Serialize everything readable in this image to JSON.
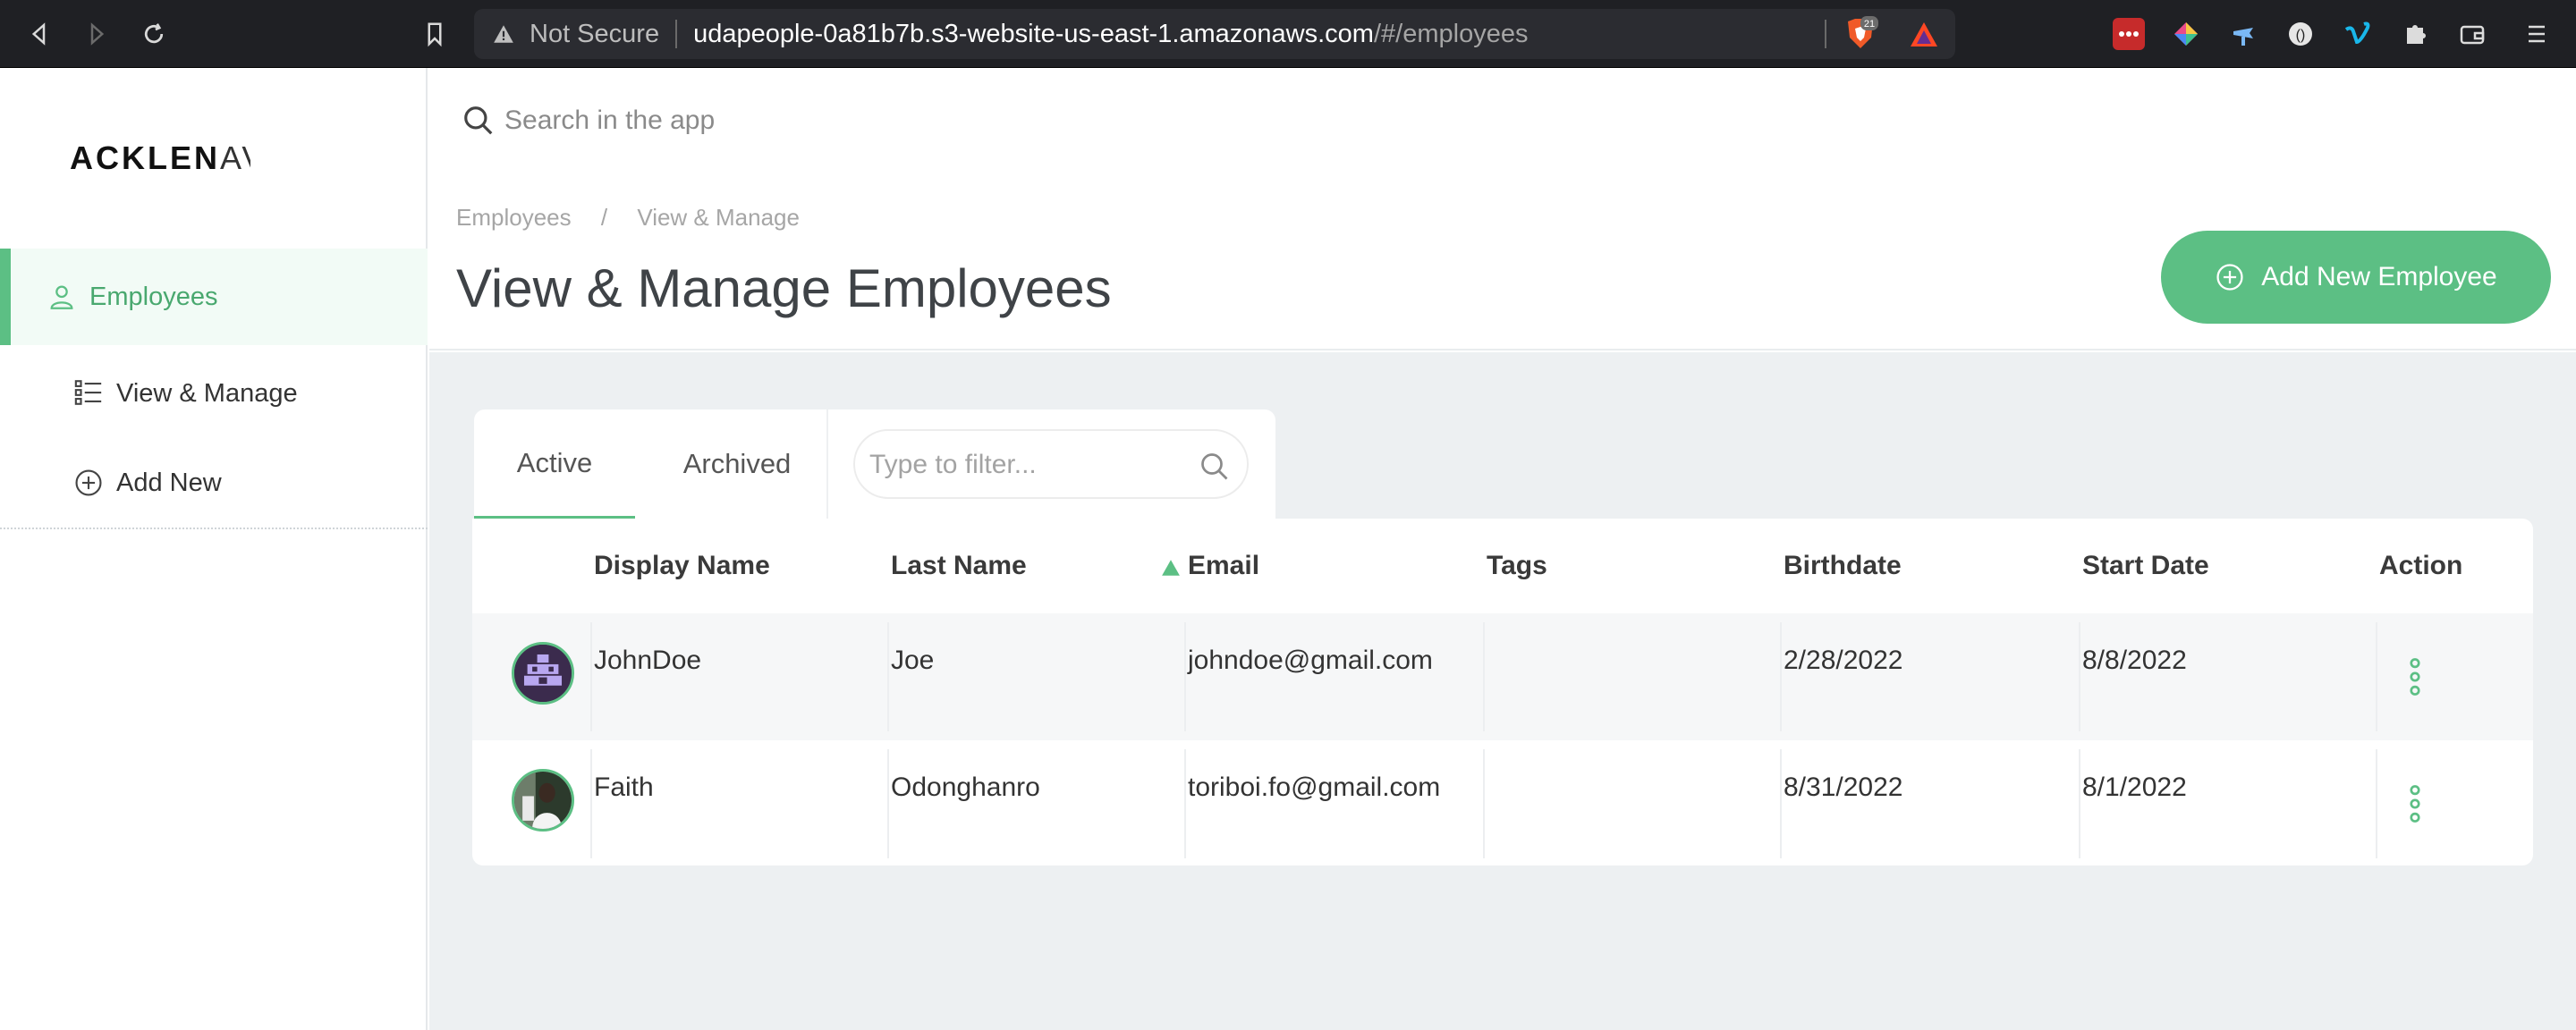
{
  "browser": {
    "security": "Not Secure",
    "url_host": "udapeople-0a81b7b.s3-website-us-east-1.amazonaws.com",
    "url_path": "/#/employees",
    "brave_count": "21"
  },
  "sidebar": {
    "logo_bold": "ACKLEN",
    "logo_thin": "AV",
    "items": [
      {
        "label": "Employees",
        "icon": "user-icon"
      },
      {
        "label": "View & Manage",
        "icon": "list-icon"
      },
      {
        "label": "Add New",
        "icon": "plus-circle-icon"
      }
    ]
  },
  "search": {
    "placeholder": "Search in the app"
  },
  "header": {
    "breadcrumb": [
      "Employees",
      "/",
      "View & Manage"
    ],
    "title": "View & Manage Employees",
    "add_button": "Add New Employee"
  },
  "tabs": [
    "Active",
    "Archived"
  ],
  "filter": {
    "placeholder": "Type to filter..."
  },
  "table": {
    "columns": [
      "Display Name",
      "Last Name",
      "Email",
      "Tags",
      "Birthdate",
      "Start Date",
      "Action"
    ],
    "rows": [
      {
        "display_name": "JohnDoe",
        "last_name": "Joe",
        "email": "johndoe@gmail.com",
        "tags": "",
        "birthdate": "2/28/2022",
        "start_date": "8/8/2022"
      },
      {
        "display_name": "Faith",
        "last_name": "Odonghanro",
        "email": "toriboi.fo@gmail.com",
        "tags": "",
        "birthdate": "8/31/2022",
        "start_date": "8/1/2022"
      }
    ]
  },
  "colors": {
    "accent": "#5cbf84",
    "chrome": "#1f2024",
    "content_bg": "#edf0f2"
  }
}
